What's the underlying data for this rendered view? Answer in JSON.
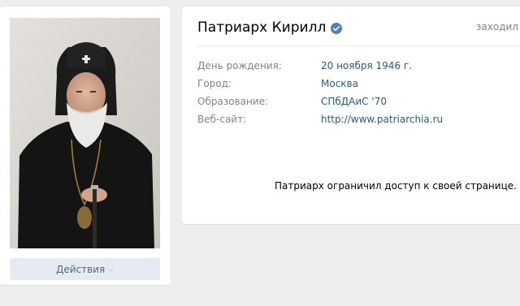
{
  "profile": {
    "name": "Патриарх Кирилл",
    "last_seen": "заходил в",
    "verified_icon": "verified-checkmark",
    "accent_color": "#5181b8"
  },
  "info": [
    {
      "label": "День рождения:",
      "value": "20 ноября 1946 г."
    },
    {
      "label": "Город:",
      "value": "Москва"
    },
    {
      "label": "Образование:",
      "value": "СПбДАиС '70"
    },
    {
      "label": "Веб-сайт:",
      "value": "http://www.patriarchia.ru"
    }
  ],
  "private_note": "Патриарх ограничил доступ к своей странице.",
  "actions": {
    "label": "Действия",
    "icon": "chevron-down-icon"
  }
}
